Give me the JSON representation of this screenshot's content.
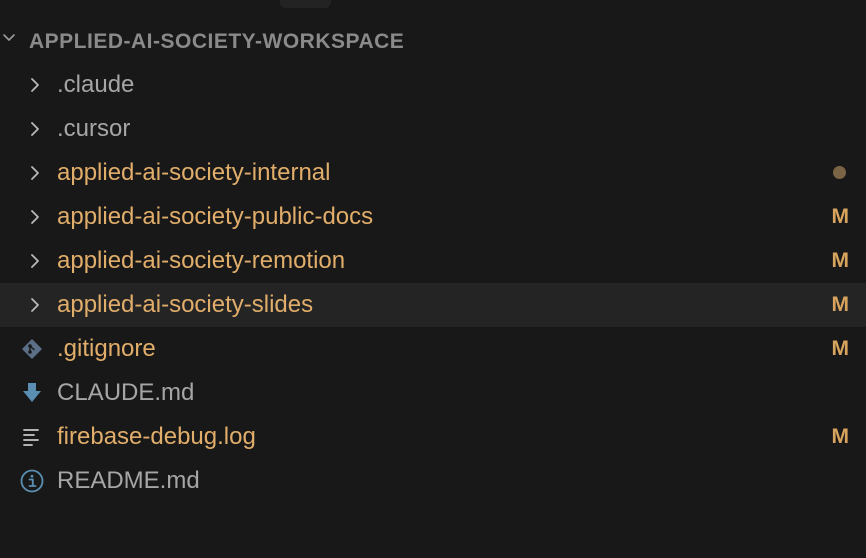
{
  "colors": {
    "background": "#181818",
    "selected_row": "#242424",
    "header_text": "#8a8a8a",
    "default_text": "#a6a6a6",
    "modified_text": "#e1ad6a",
    "status_modified": "#d7a35d",
    "dot": "#7b6445",
    "chevron": "#b8b8b8",
    "file_icon_blue": "#5a8fb3"
  },
  "section": {
    "title": "APPLIED-AI-SOCIETY-WORKSPACE",
    "chevron_icon": "chevron-down-icon"
  },
  "items": [
    {
      "label": ".claude",
      "kind": "folder",
      "icon": "chevron-right-icon",
      "status": "",
      "color": "default"
    },
    {
      "label": ".cursor",
      "kind": "folder",
      "icon": "chevron-right-icon",
      "status": "",
      "color": "default"
    },
    {
      "label": "applied-ai-society-internal",
      "kind": "folder",
      "icon": "chevron-right-icon",
      "status": "dot",
      "color": "modified"
    },
    {
      "label": "applied-ai-society-public-docs",
      "kind": "folder",
      "icon": "chevron-right-icon",
      "status": "M",
      "color": "modified"
    },
    {
      "label": "applied-ai-society-remotion",
      "kind": "folder",
      "icon": "chevron-right-icon",
      "status": "M",
      "color": "modified"
    },
    {
      "label": "applied-ai-society-slides",
      "kind": "folder",
      "icon": "chevron-right-icon",
      "status": "M",
      "color": "modified",
      "selected": true
    },
    {
      "label": ".gitignore",
      "kind": "file",
      "icon": "git-diamond-icon",
      "status": "M",
      "color": "modified"
    },
    {
      "label": "CLAUDE.md",
      "kind": "file",
      "icon": "download-arrow-icon",
      "status": "",
      "color": "default"
    },
    {
      "label": "firebase-debug.log",
      "kind": "file",
      "icon": "log-lines-icon",
      "status": "M",
      "color": "modified"
    },
    {
      "label": "README.md",
      "kind": "file",
      "icon": "info-circle-icon",
      "status": "",
      "color": "default"
    }
  ]
}
